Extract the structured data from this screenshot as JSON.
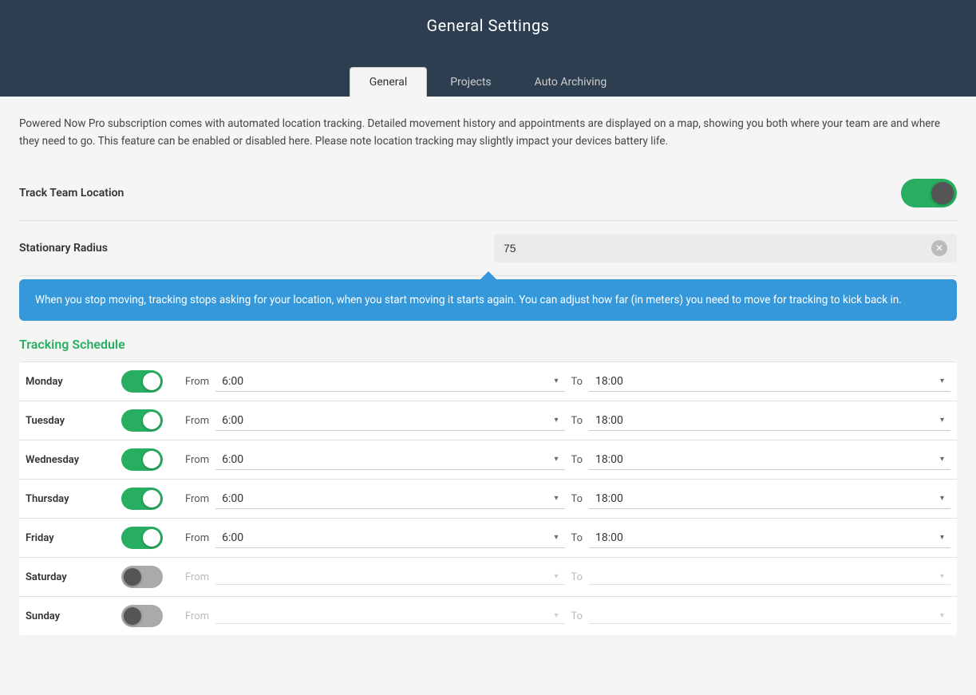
{
  "header": {
    "title": "General Settings"
  },
  "tabs": [
    {
      "id": "general",
      "label": "General",
      "active": true
    },
    {
      "id": "projects",
      "label": "Projects",
      "active": false
    },
    {
      "id": "auto-archiving",
      "label": "Auto Archiving",
      "active": false
    }
  ],
  "description": "Powered Now Pro subscription comes with automated location tracking. Detailed movement history and appointments are displayed on a map, showing you both where your team are and where they need to go. This feature can be enabled or disabled here. Please note location tracking may slightly impact your devices battery life.",
  "track_team_location": {
    "label": "Track Team Location",
    "enabled": true
  },
  "stationary_radius": {
    "label": "Stationary Radius",
    "value": "75",
    "placeholder": "75"
  },
  "tooltip": "When you stop moving, tracking stops asking for your location, when you start moving it starts again. You can adjust how far (in meters) you need to move for tracking to kick back in.",
  "tracking_schedule": {
    "title": "Tracking Schedule",
    "days": [
      {
        "name": "Monday",
        "enabled": true,
        "from": "6:00",
        "to": "18:00"
      },
      {
        "name": "Tuesday",
        "enabled": true,
        "from": "6:00",
        "to": "18:00"
      },
      {
        "name": "Wednesday",
        "enabled": true,
        "from": "6:00",
        "to": "18:00"
      },
      {
        "name": "Thursday",
        "enabled": true,
        "from": "6:00",
        "to": "18:00"
      },
      {
        "name": "Friday",
        "enabled": true,
        "from": "6:00",
        "to": "18:00"
      },
      {
        "name": "Saturday",
        "enabled": false,
        "from": "",
        "to": ""
      },
      {
        "name": "Sunday",
        "enabled": false,
        "from": "",
        "to": ""
      }
    ],
    "from_label": "From",
    "to_label": "To"
  }
}
